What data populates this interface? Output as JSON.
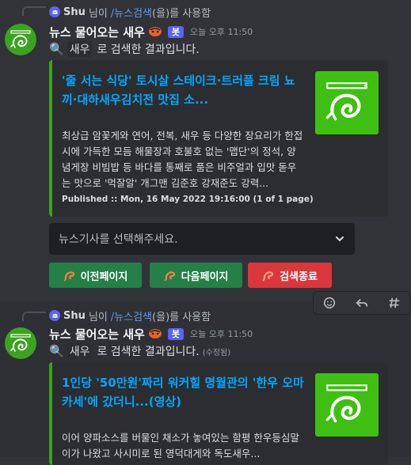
{
  "toolbar": {
    "icons": [
      "add-reaction-icon",
      "reply-icon",
      "create-thread-icon"
    ]
  },
  "messages": [
    {
      "command": {
        "user": "Shu",
        "suffix": "님이",
        "name": "/뉴스검색",
        "tail": "(을)를 사용함"
      },
      "author": {
        "name": "뉴스 물어오는 새우",
        "bot_tag": "봇",
        "timestamp": "오늘 오후 11:50"
      },
      "content": {
        "keyword": "새우",
        "text": "로 검색한 결과입니다.",
        "edited": ""
      },
      "embed": {
        "title": "'줄 서는 식당' 토시살 스테이크·트러플 크림 뇨끼·대하새우김치전 맛집 소...",
        "description": "최상급 암꽃게와 연어, 전복, 새우 등 다양한 장요리가 한접시에 가득한 모듬 해물장과 호불호 없는 '맵단'의 정석, 양념게장 비빔밥 등 바다를 통째로 품은 비주얼과 입맛 돋우는 맛으로 '먹잘알' 개그맨 김준호 강재준도 강력...",
        "footer": "Published :: Mon, 16 May 2022 19:16:00  (1 of 1 page)"
      },
      "select_placeholder": "뉴스기사를 선택해주세요.",
      "buttons": {
        "prev": "이전페이지",
        "next": "다음페이지",
        "end": "검색종료"
      }
    },
    {
      "command": {
        "user": "Shu",
        "suffix": "님이",
        "name": "/뉴스검색",
        "tail": "(을)를 사용함"
      },
      "author": {
        "name": "뉴스 물어오는 새우",
        "bot_tag": "봇",
        "timestamp": "오늘 오후 11:50"
      },
      "content": {
        "keyword": "새우",
        "text": "로 검색한 결과입니다.",
        "edited": "(수정됨)"
      },
      "embed": {
        "title": "1인당 '50만원'짜리 워커힐 명월관의 '한우 오마카세'에 갔더니...(영상)",
        "description": "이어 양파소스를 버물인 채소가 놓여있는 함평 한우등심말이가 나왔고 사시미로 된 영덕대게와 독도새우..."
      }
    }
  ],
  "colors": {
    "accent": "#3ba31f",
    "link": "#00a8fc",
    "blurple": "#5865f2",
    "danger": "#da373c",
    "success": "#248046"
  }
}
